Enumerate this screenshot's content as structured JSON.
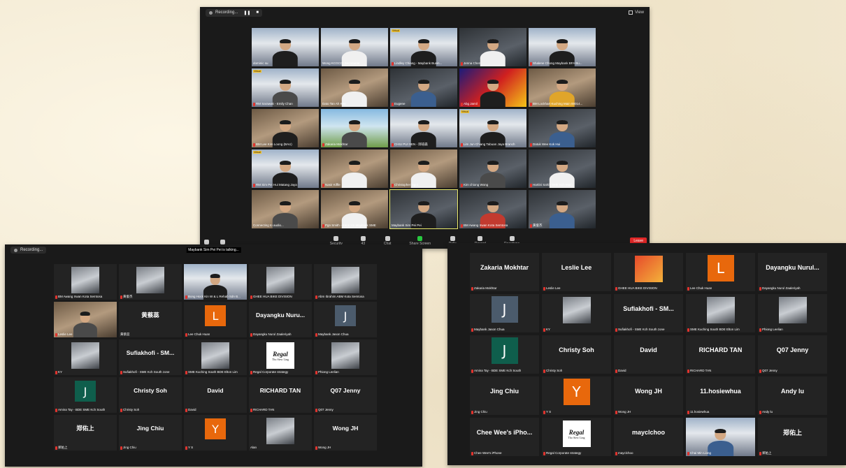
{
  "top_window": {
    "recording": "Recording...",
    "view_label": "View",
    "toolbar": [
      "Security",
      "Participants",
      "Chat",
      "Share Screen",
      "Polls",
      "Record",
      "Reactions"
    ],
    "participants_count": "43",
    "leave_label": "Leave",
    "tiles": [
      {
        "name": "dominic su"
      },
      {
        "name": "Wong KCGCCI Secretariat"
      },
      {
        "name": "Lindley Chiang - Maybank Busin..."
      },
      {
        "name": "Jenna Chen"
      },
      {
        "name": "Shalene Chong Maybank BFA Bu..."
      },
      {
        "name": "RM Sarawak - Emily Chan"
      },
      {
        "name": "Dato Tan Ah Kee"
      },
      {
        "name": "Eugene"
      },
      {
        "name": "Abg Jamil"
      },
      {
        "name": "BM Lockhart Kuching Main 00014..."
      },
      {
        "name": "BM Lee Kim Loong (BAU)"
      },
      {
        "name": "Zakaria Mokhtar"
      },
      {
        "name": "CHIU PUI SEN - 邱培森"
      },
      {
        "name": "Lim Jun Chiang Tabuan Jaya Branch"
      },
      {
        "name": "Datuk Wee Kok Hui"
      },
      {
        "name": "RM Sim Pei Hui Matang Jaya"
      },
      {
        "name": "Nasir Kiffle"
      },
      {
        "name": "Christopher Ngui"
      },
      {
        "name": "Kim chiong Wong"
      },
      {
        "name": "Hartini Sahib SME Kch Main"
      },
      {
        "name": "Connecting to audio..."
      },
      {
        "name": "Pgn Smith - Kenn Ho Maybank SME"
      },
      {
        "name": "Maybank Sim Pei Pei"
      },
      {
        "name": "BM Awang Irwan Kota Semtosa"
      },
      {
        "name": "黄俊杰"
      }
    ]
  },
  "left_window": {
    "recording": "Recording...",
    "talking_banner": "Maybank Sim Pei Pei is talking...",
    "tiles": [
      {
        "caption": "BM Awang Irwan Kota Semtosa"
      },
      {
        "caption": "黄俊杰"
      },
      {
        "caption": "Bong Hock Kin W & L Rehab Sdn B..."
      },
      {
        "caption": "GHEE HUA BIKE DIVISION"
      },
      {
        "caption": "Abm Ibrahim ABM Kota Semtosa"
      },
      {
        "caption": "Leslie Lee"
      },
      {
        "big": "黄蔡蕊",
        "caption": "黄蔡蕊"
      },
      {
        "avatar": "L",
        "caption": "Lee Chuk Huan"
      },
      {
        "big": "Dayangku Nuru...",
        "caption": "Dayangku Nurul Zaaleriyah"
      },
      {
        "avatar": "J",
        "caption": "Maybank Jason Chua"
      },
      {
        "caption": "KY"
      },
      {
        "big": "Sufiakhofi - SM...",
        "caption": "Sufiakhofi - SME Kch South zone"
      },
      {
        "caption": "SME Kuching South BDE Elton Lim"
      },
      {
        "regal": "Regal",
        "regal_sub": "Tho Siew Ling",
        "caption": "Regal Corporate strategy"
      },
      {
        "caption": "Phiong Leelian"
      },
      {
        "avatar": "J",
        "caption": "Amina Tay - BDE SME Kch South"
      },
      {
        "big": "Christy Soh",
        "caption": "Christy Soh"
      },
      {
        "big": "David",
        "caption": "David"
      },
      {
        "big": "RICHARD TAN",
        "caption": "RICHARD TAN"
      },
      {
        "big": "Q07 Jenny",
        "caption": "Q07 Jenny"
      },
      {
        "big": "郑佑上",
        "caption": "郑佑上"
      },
      {
        "big": "Jing Chiu",
        "caption": "Jing Chiu"
      },
      {
        "avatar": "Y",
        "caption": "Y S"
      },
      {
        "caption": "Alan"
      },
      {
        "big": "Wong JH",
        "caption": "Wong JH"
      }
    ]
  },
  "right_window": {
    "tiles": [
      {
        "big": "Zakaria Mokhtar",
        "caption": "Zakaria Mokhtar"
      },
      {
        "big": "Leslie Lee",
        "caption": "Leslie Lee"
      },
      {
        "caption": "GHEE HUA BIKE DIVISION"
      },
      {
        "avatar": "L",
        "caption": "Lee Chuk Huan"
      },
      {
        "big": "Dayangku Nurul...",
        "caption": "Dayangku Nurul Zaaleriyah"
      },
      {
        "avatar": "J",
        "caption": "Maybank Jason Chua"
      },
      {
        "caption": "KY"
      },
      {
        "big": "Sufiakhofi - SM...",
        "caption": "Sufiakhofi - SME Kch South zone"
      },
      {
        "caption": "SME Kuching South BDE Elton Lim"
      },
      {
        "caption": "Phiong Leelian"
      },
      {
        "avatar": "J",
        "caption": "Amina Tay - BDE SME Kch South"
      },
      {
        "big": "Christy Soh",
        "caption": "Christy Soh"
      },
      {
        "big": "David",
        "caption": "David"
      },
      {
        "big": "RICHARD TAN",
        "caption": "RICHARD TAN"
      },
      {
        "big": "Q07 Jenny",
        "caption": "Q07 Jenny"
      },
      {
        "big": "Jing Chiu",
        "caption": "Jing Chiu"
      },
      {
        "avatar": "Y",
        "caption": "Y S"
      },
      {
        "big": "Wong JH",
        "caption": "Wong JH"
      },
      {
        "big": "11.hosiewhua",
        "caption": "11.hosiewhua"
      },
      {
        "big": "Andy lu",
        "caption": "Andy lu"
      },
      {
        "big": "Chee Wee's iPho...",
        "caption": "Chee Wee's iPhone"
      },
      {
        "regal": "Regal",
        "regal_sub": "Tho Siew Ling",
        "caption": "Regal Corporate strategy"
      },
      {
        "big": "mayclchoo",
        "caption": "mayclchoo"
      },
      {
        "caption": "Chai Min Liong"
      },
      {
        "big": "郑佑上",
        "caption": "郑佑上"
      }
    ]
  },
  "colors": {
    "mic_muted": "#e0332d",
    "avatar_orange": "#e8680c",
    "avatar_teal": "#0f5e4c",
    "avatar_slate": "#4b5b6c",
    "active_border": "#e9e96b",
    "leave": "#e02828"
  }
}
